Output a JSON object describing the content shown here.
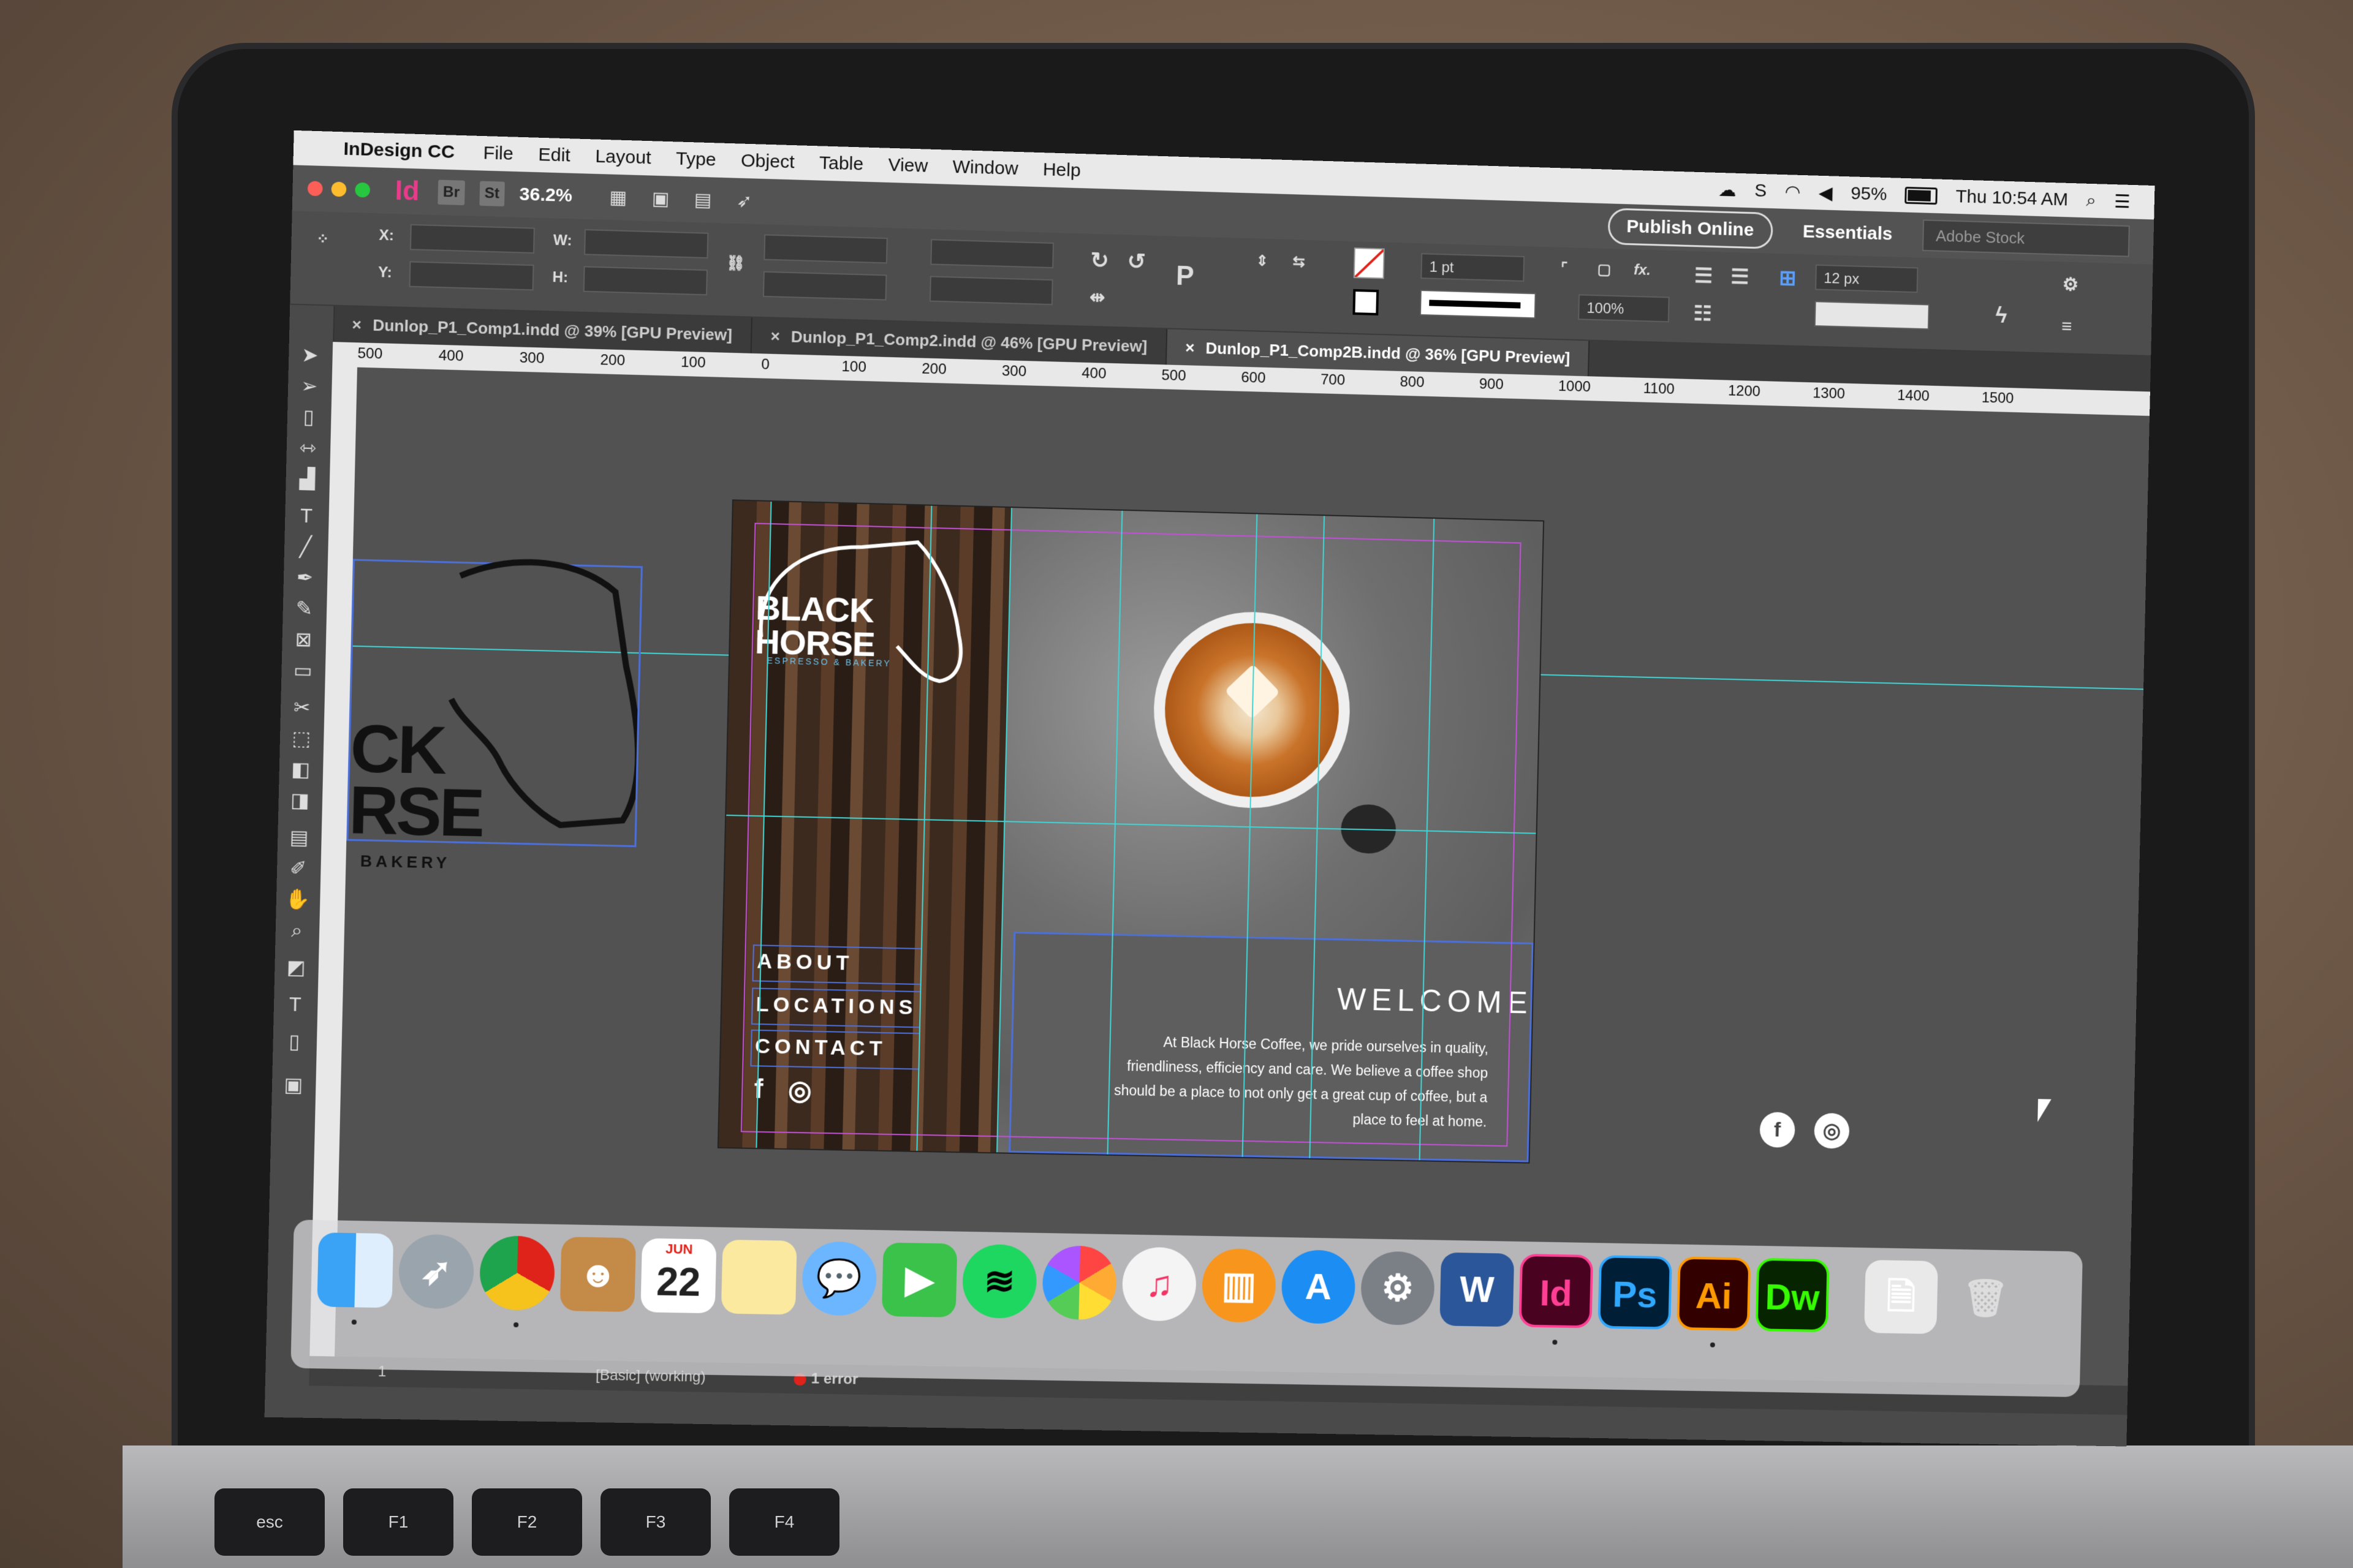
{
  "menubar": {
    "app_name": "InDesign CC",
    "items": [
      "File",
      "Edit",
      "Layout",
      "Type",
      "Object",
      "Table",
      "View",
      "Window",
      "Help"
    ],
    "battery": "95%",
    "clock": "Thu 10:54 AM"
  },
  "appbar": {
    "app_icon": "Id",
    "bridge": "Br",
    "stock_app": "St",
    "zoom": "36.2%",
    "publish_online": "Publish Online",
    "workspace": "Essentials",
    "search_placeholder": "Adobe Stock"
  },
  "control_panel": {
    "x_label": "X:",
    "y_label": "Y:",
    "w_label": "W:",
    "h_label": "H:",
    "stroke_weight": "1 pt",
    "opacity": "100%",
    "column_gutter": "12 px"
  },
  "tabs": [
    {
      "label": "Dunlop_P1_Comp1.indd @ 39% [GPU Preview]"
    },
    {
      "label": "Dunlop_P1_Comp2.indd @ 46% [GPU Preview]"
    },
    {
      "label": "Dunlop_P1_Comp2B.indd @ 36% [GPU Preview]"
    }
  ],
  "ruler": {
    "ticks": [
      "500",
      "400",
      "300",
      "200",
      "100",
      "0",
      "100",
      "200",
      "300",
      "400",
      "500",
      "600",
      "700",
      "800",
      "900",
      "1000",
      "1100",
      "1200",
      "1300",
      "1400",
      "1500"
    ]
  },
  "left_page": {
    "text_a": "CK",
    "text_b": "RSE",
    "text_c": "BAKERY"
  },
  "document": {
    "logo_line1": "BLACK",
    "logo_line2": "HORSE",
    "logo_tagline": "ESPRESSO & BAKERY",
    "nav": [
      "ABOUT",
      "LOCATIONS",
      "CONTACT"
    ],
    "welcome": "WELCOME",
    "body": "At Black Horse Coffee, we pride ourselves in quality, friendliness, efficiency and care. We believe a coffee shop should be a place to not only get a great cup of coffee, but a place to feel at home.",
    "facebook": "f",
    "instagram": "◎"
  },
  "status": {
    "page": "1",
    "preflight_profile": "[Basic] (working)",
    "errors": "1 error"
  },
  "dock": {
    "calendar_month": "JUN",
    "calendar_day": "22",
    "indesign": "Id",
    "photoshop": "Ps",
    "illustrator": "Ai",
    "dreamweaver": "Dw",
    "word": "W"
  },
  "keyboard": {
    "esc": "esc",
    "f1": "F1",
    "f2": "F2",
    "f3": "F3",
    "f4": "F4"
  }
}
